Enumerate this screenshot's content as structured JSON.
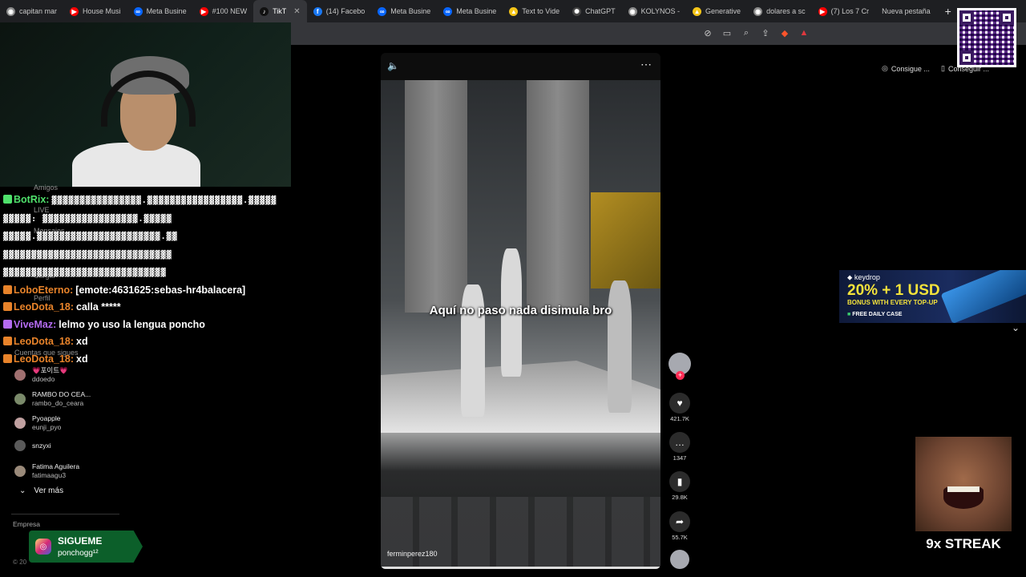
{
  "browser": {
    "tabs": [
      {
        "label": "capitan mar",
        "color": "#8a8a8a",
        "glyph": "◉"
      },
      {
        "label": "House Musi",
        "color": "#ff0000",
        "glyph": "▶"
      },
      {
        "label": "Meta Busine",
        "color": "#0866ff",
        "glyph": "∞"
      },
      {
        "label": "#100 NEW",
        "color": "#ff0000",
        "glyph": "▶"
      },
      {
        "label": "TikT",
        "color": "#111111",
        "glyph": "♪",
        "active": true
      },
      {
        "label": "(14) Facebo",
        "color": "#1877f2",
        "glyph": "f"
      },
      {
        "label": "Meta Busine",
        "color": "#0866ff",
        "glyph": "∞"
      },
      {
        "label": "Meta Busine",
        "color": "#0866ff",
        "glyph": "∞"
      },
      {
        "label": "Text to Vide",
        "color": "#f5c518",
        "glyph": "▲"
      },
      {
        "label": "ChatGPT",
        "color": "#444444",
        "glyph": "✺"
      },
      {
        "label": "KOLYNOS -",
        "color": "#8a8a8a",
        "glyph": "◉"
      },
      {
        "label": "Generative",
        "color": "#f5c518",
        "glyph": "▲"
      },
      {
        "label": "dolares a sc",
        "color": "#8a8a8a",
        "glyph": "◉"
      },
      {
        "label": "(7) Los 7 Cr",
        "color": "#ff0000",
        "glyph": "▶"
      },
      {
        "label": "Nueva pestaña",
        "color": "",
        "glyph": ""
      }
    ],
    "new_tab": "+"
  },
  "chat": [
    {
      "user": "BotRix:",
      "color": "#4fe06b",
      "text": "▓▓▓▓▓▓▓▓▓▓▓▓▓▓▓▓.▓▓▓▓▓▓▓▓▓▓▓▓▓▓▓▓▓.▓▓▓▓▓",
      "garbled": true
    },
    {
      "user": "",
      "color": "#ffffff",
      "text": "▓▓▓▓▓: ▓▓▓▓▓▓▓▓▓▓▓▓▓▓▓▓▓.▓▓▓▓▓",
      "garbled": true
    },
    {
      "user": "",
      "color": "#ffffff",
      "text": "▓▓▓▓▓.▓▓▓▓▓▓▓▓▓▓▓▓▓▓▓▓▓▓▓▓▓▓.▓▓",
      "garbled": true
    },
    {
      "user": "",
      "color": "#ffffff",
      "text": "▓▓▓▓▓▓▓▓▓▓▓▓▓▓▓▓▓▓▓▓▓▓▓▓▓▓▓▓▓▓",
      "garbled": true
    },
    {
      "user": "",
      "color": "#ffffff",
      "text": "▓▓▓▓▓▓▓▓▓▓▓▓▓▓▓▓▓▓▓▓▓▓▓▓▓▓▓▓▓",
      "garbled": true
    },
    {
      "user": "LoboEterno:",
      "color": "#e8832a",
      "text": "[emote:4631625:sebas-hr4balacera]",
      "garbled": false
    },
    {
      "user": "LeoDota_18:",
      "color": "#e8832a",
      "text": "calla *****",
      "garbled": false
    },
    {
      "user": "ViveMaz:",
      "color": "#b46bf0",
      "text": "lelmo yo uso la lengua poncho",
      "garbled": false
    },
    {
      "user": "LeoDota_18:",
      "color": "#e8832a",
      "text": "xd",
      "garbled": false
    },
    {
      "user": "LeoDota_18:",
      "color": "#e8832a",
      "text": "xd",
      "garbled": false
    }
  ],
  "sidebar": {
    "ghost_labels": [
      "Amigos",
      "LIVE",
      "Mensajes",
      "Actividad",
      "Cargar",
      "Perfil",
      "Cuentas que sigues"
    ],
    "following": [
      {
        "name": "💗포이트💗",
        "handle": "ddoedo"
      },
      {
        "name": "RAMBO DO CEA...",
        "handle": "rambo_do_ceara"
      },
      {
        "name": "Pyoapple",
        "handle": "eunji_pyo"
      },
      {
        "name": "snzyxi",
        "handle": ""
      },
      {
        "name": "Fatima Aguilera",
        "handle": "fatimaagu3"
      }
    ],
    "ver_mas": "Ver más",
    "empresa": "Empresa",
    "copyright": "© 20"
  },
  "sigueme": {
    "title": "SIGUEME",
    "handle": "ponchogg¹²"
  },
  "video": {
    "caption": "Aquí no paso nada disimula bro",
    "author": "ferminperez180",
    "progress_fraction": 1.0
  },
  "actions": {
    "likes": "421.7K",
    "comments": "1347",
    "saves": "29.8K",
    "shares": "55.7K"
  },
  "top_right": {
    "button_a": "Consigue ...",
    "button_b": "Conseguir ..."
  },
  "ad": {
    "brand": "keydrop",
    "headline": "20% + 1 USD",
    "bonus": "BONUS WITH EVERY TOP-UP",
    "daily": "FREE DAILY CASE"
  },
  "streak": {
    "label": "9x STREAK"
  }
}
